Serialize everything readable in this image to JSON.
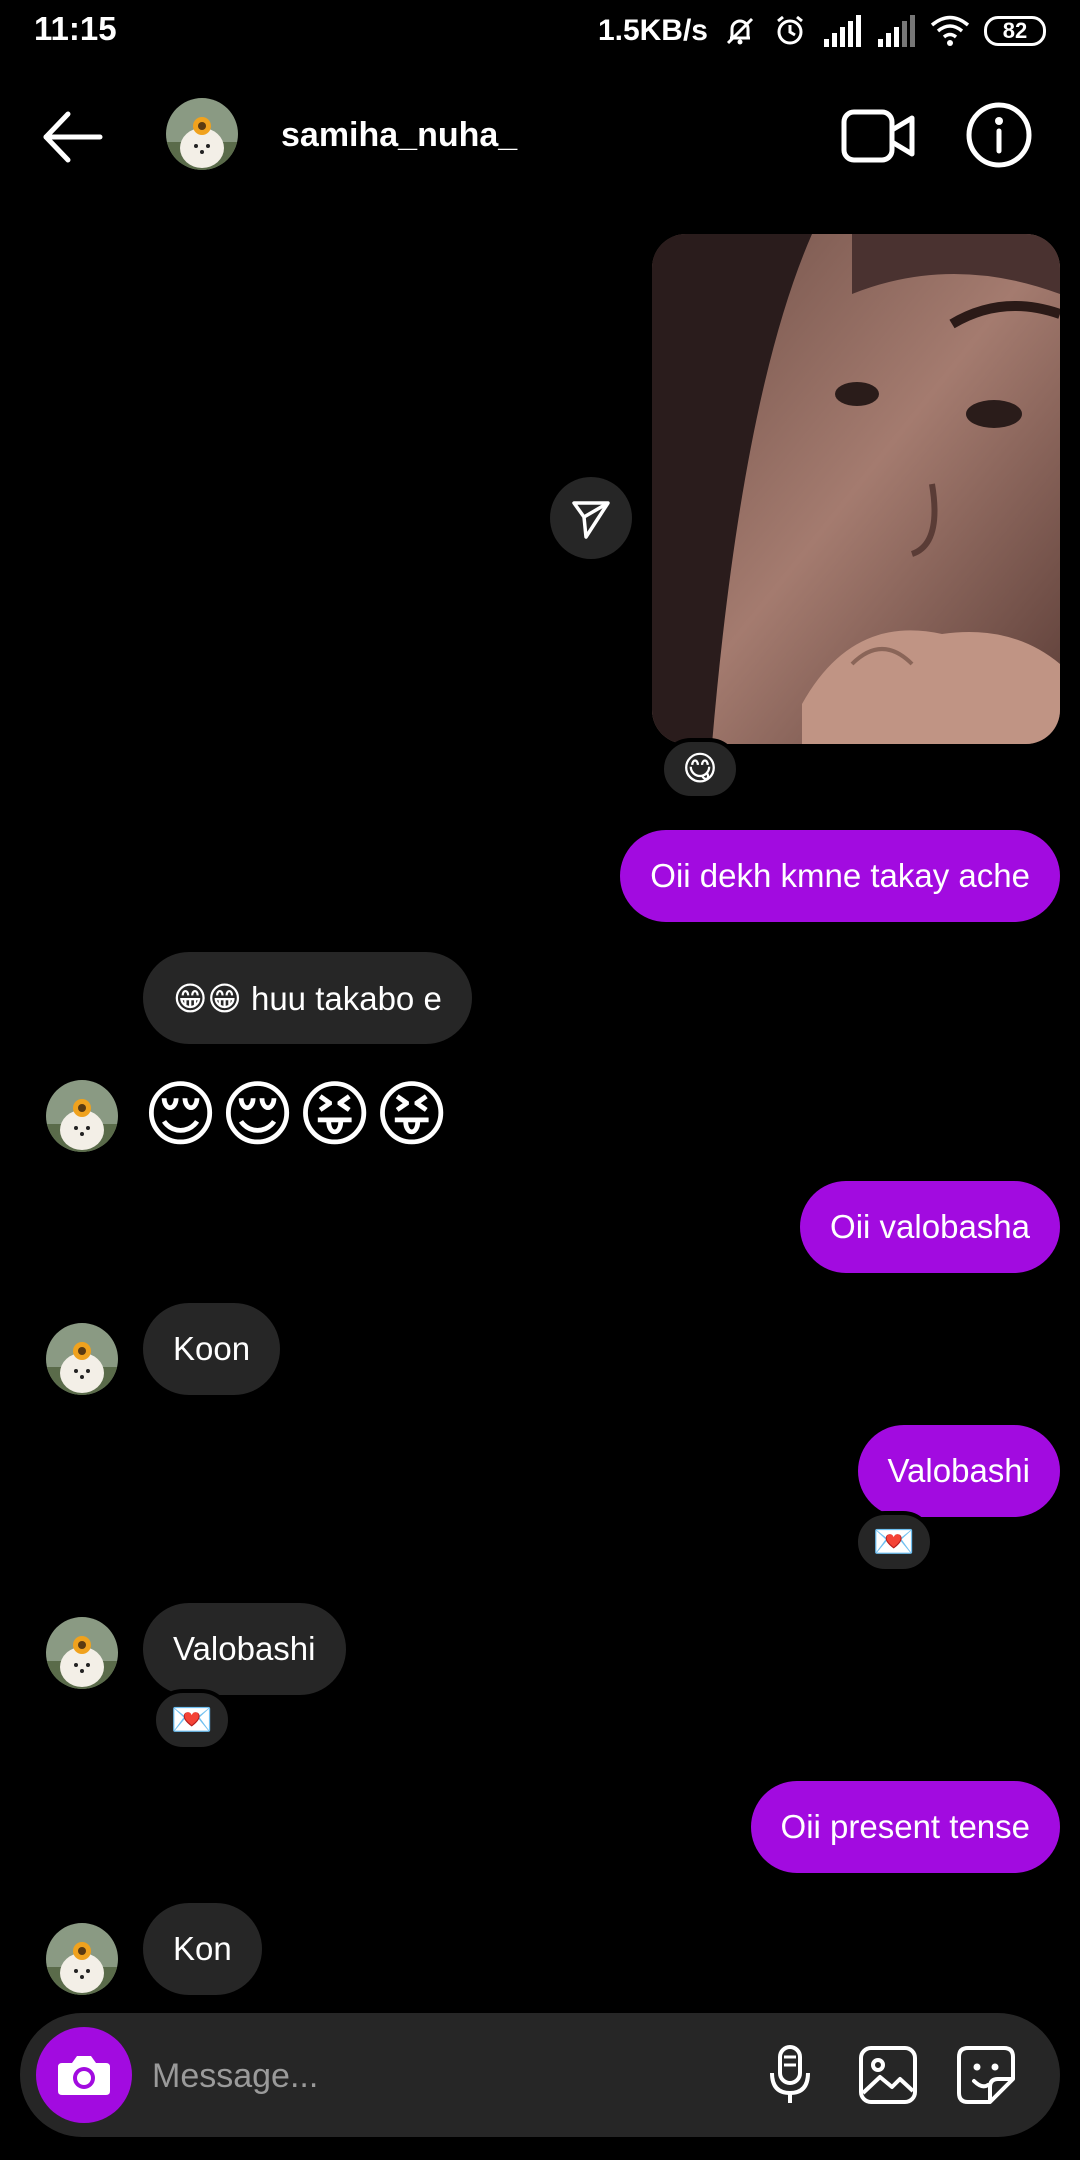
{
  "status_bar": {
    "time": "11:15",
    "speed": "1.5KB/s",
    "battery": "82",
    "icons": [
      "mute-bell-icon",
      "alarm-icon",
      "signal-icon",
      "signal-icon",
      "wifi-icon",
      "battery-icon"
    ]
  },
  "header": {
    "username": "samiha_nuha_",
    "icons": [
      "back-arrow-icon",
      "video-call-icon",
      "info-icon"
    ]
  },
  "messages": {
    "photo_reaction": "😋",
    "m1": "Oii dekh kmne takay ache",
    "m2": "😁😁 huu takabo e",
    "m3": "😌😌😝😝",
    "m4": "Oii valobasha",
    "m5": "Koon",
    "m6": "Valobashi",
    "m6_reaction": "💌",
    "m7": "Valobashi",
    "m7_reaction": "💌",
    "m8": "Oii present tense",
    "m9": "Kon"
  },
  "composer": {
    "placeholder": "Message...",
    "icons": [
      "camera-icon",
      "microphone-icon",
      "gallery-icon",
      "sticker-icon"
    ]
  },
  "colors": {
    "sent_bubble": "#a20be0",
    "received_bubble": "#262626",
    "background": "#000000"
  }
}
